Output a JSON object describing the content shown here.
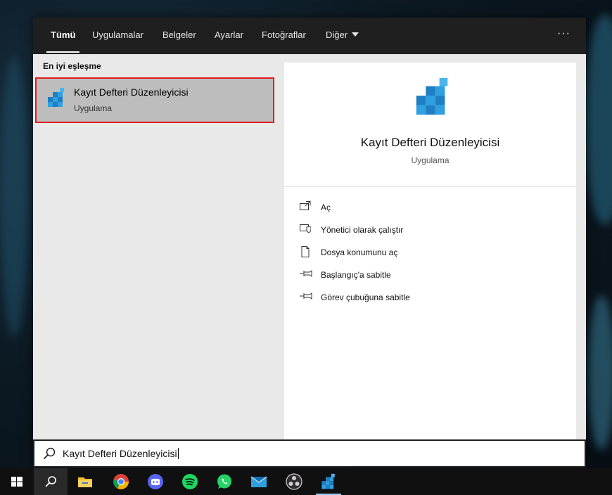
{
  "nav": {
    "tabs": [
      {
        "label": "Tümü",
        "active": true
      },
      {
        "label": "Uygulamalar"
      },
      {
        "label": "Belgeler"
      },
      {
        "label": "Ayarlar"
      },
      {
        "label": "Fotoğraflar"
      },
      {
        "label": "Diğer"
      }
    ],
    "more_label": "···"
  },
  "best_match": {
    "header": "En iyi eşleşme",
    "title": "Kayıt Defteri Düzenleyicisi",
    "subtitle": "Uygulama"
  },
  "detail": {
    "title": "Kayıt Defteri Düzenleyicisi",
    "subtitle": "Uygulama",
    "actions": [
      {
        "label": "Aç",
        "icon": "open-icon"
      },
      {
        "label": "Yönetici olarak çalıştır",
        "icon": "shield-icon"
      },
      {
        "label": "Dosya konumunu aç",
        "icon": "file-location-icon"
      },
      {
        "label": "Başlangıç'a sabitle",
        "icon": "pin-icon"
      },
      {
        "label": "Görev çubuğuna sabitle",
        "icon": "pin-icon"
      }
    ]
  },
  "search": {
    "value": "Kayıt Defteri Düzenleyicisi"
  },
  "taskbar": {
    "items": [
      "windows-start-icon",
      "search-icon",
      "file-explorer-icon",
      "chrome-icon",
      "discord-icon",
      "spotify-icon",
      "whatsapp-icon",
      "mail-icon",
      "obs-icon",
      "registry-editor-icon"
    ]
  },
  "colors": {
    "highlight_border": "#e11c1c",
    "accent_blue": "#2f9fe0"
  }
}
